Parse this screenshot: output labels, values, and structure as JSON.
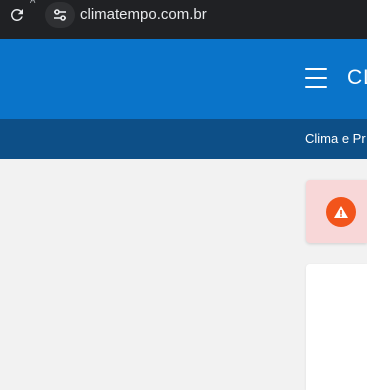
{
  "browser": {
    "url": "climatempo.com.br",
    "tiny_mark": "A",
    "icons": {
      "reload": "reload-icon",
      "site_info": "tune-icon"
    }
  },
  "header": {
    "logo_text": "CL",
    "menu_icon": "hamburger-menu-icon",
    "background": "#0a74c9"
  },
  "subnav": {
    "link_label": "Clima e Pr",
    "background": "#0d4f87"
  },
  "alert": {
    "icon": "warning-triangle-icon",
    "icon_color": "#f2541b",
    "background": "#f8d7d8"
  }
}
